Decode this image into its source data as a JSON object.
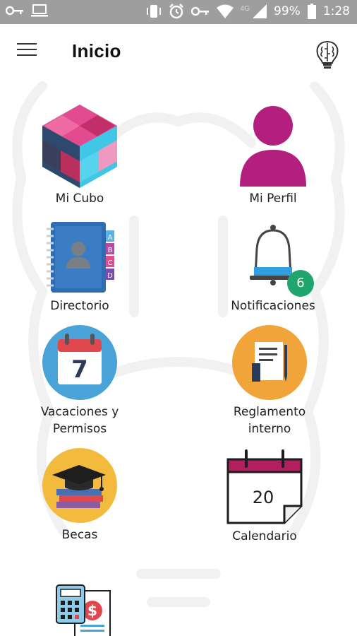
{
  "status_bar": {
    "battery": "99%",
    "time": "1:28",
    "network": "4G",
    "icons": [
      "key-icon",
      "laptop-icon",
      "vibrate-icon",
      "alarm-icon",
      "vpn-key-icon",
      "wifi-icon",
      "signal-icon",
      "battery-icon"
    ]
  },
  "app_bar": {
    "title": "Inicio",
    "menu_icon": "hamburger-menu-icon",
    "action_icon": "brain-lightbulb-icon"
  },
  "tiles": [
    {
      "label": "Mi Cubo",
      "icon": "cube-icon"
    },
    {
      "label": "Mi Perfil",
      "icon": "person-icon"
    },
    {
      "label": "Directorio",
      "icon": "address-book-icon"
    },
    {
      "label": "Notificaciones",
      "icon": "bell-icon",
      "badge": "6"
    },
    {
      "label_line1": "Vacaciones y",
      "label_line2": "Permisos",
      "icon": "calendar-7-icon",
      "day": "7"
    },
    {
      "label_line1": "Reglamento",
      "label_line2": "interno",
      "icon": "document-icon"
    },
    {
      "label": "Becas",
      "icon": "graduation-cap-books-icon"
    },
    {
      "label": "Calendario",
      "icon": "calendar-page-icon",
      "day": "20"
    },
    {
      "label": "",
      "icon": "calculator-payroll-icon"
    }
  ],
  "colors": {
    "status_bar": "#9e9e9e",
    "profile": "#b21f7c",
    "directory": "#2f6db3",
    "calendar_circle": "#4aa3d8",
    "calendar_red": "#e0484e",
    "rules_circle": "#f0a43a",
    "becas_circle": "#f3bb3d",
    "badge": "#1fa56d"
  }
}
